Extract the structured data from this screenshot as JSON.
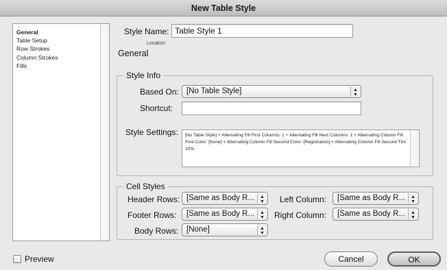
{
  "window": {
    "title": "New Table Style"
  },
  "sidebar": {
    "items": [
      {
        "label": "General",
        "selected": true
      },
      {
        "label": "Table Setup"
      },
      {
        "label": "Row Strokes"
      },
      {
        "label": "Column Strokes"
      },
      {
        "label": "Fills"
      }
    ]
  },
  "header": {
    "style_name_label": "Style Name:",
    "style_name_value": "Table Style 1",
    "location_label": "Location:",
    "section_title": "General"
  },
  "style_info": {
    "group_title": "Style Info",
    "based_on_label": "Based On:",
    "based_on_value": "[No Table Style]",
    "shortcut_label": "Shortcut:",
    "shortcut_value": "",
    "settings_label": "Style Settings:",
    "settings_text": "[No Table Style] + Alternating Fill First Columns: 1 + Alternating Fill Next Columns: 1 + Alternating Column Fill First Color: [None] + Alternating Column Fill Second Color: [Registration] + Alternating Column Fill Second Tint: 10%"
  },
  "cell_styles": {
    "group_title": "Cell Styles",
    "header_rows_label": "Header Rows:",
    "header_rows_value": "[Same as Body R...",
    "footer_rows_label": "Footer Rows:",
    "footer_rows_value": "[Same as Body R...",
    "body_rows_label": "Body Rows:",
    "body_rows_value": "[None]",
    "left_column_label": "Left Column:",
    "left_column_value": "[Same as Body R...",
    "right_column_label": "Right Column:",
    "right_column_value": "[Same as Body R..."
  },
  "footer": {
    "preview_label": "Preview",
    "cancel_label": "Cancel",
    "ok_label": "OK"
  },
  "icons": {
    "select_arrows": "updown-arrows-icon"
  }
}
